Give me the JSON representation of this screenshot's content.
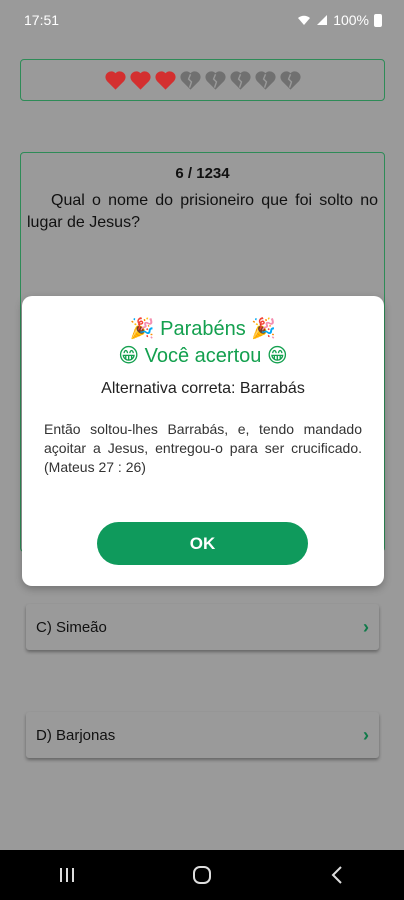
{
  "status_bar": {
    "time": "17:51",
    "battery": "100%"
  },
  "lives": {
    "total": 8,
    "remaining": 3,
    "full_color": "#d32f2f",
    "empty_color": "#707070"
  },
  "question": {
    "counter": "6 / 1234",
    "text": "Qual o nome do prisioneiro que foi solto no lugar de Jesus?"
  },
  "answers": [
    {
      "label": "C) Simeão"
    },
    {
      "label": "D) Barjonas"
    }
  ],
  "dialog": {
    "title1": "🎉 Parabéns 🎉",
    "title2": "😁 Você acertou 😁",
    "correct_answer": "Alternativa correta: Barrabás",
    "verse": "Então soltou-lhes Barrabás, e, tendo mandado açoitar a Jesus, entregou-o para ser crucificado. (Mateus 27 : 26)",
    "ok_label": "OK"
  },
  "colors": {
    "accent": "#0f9a5c",
    "border": "#2e8b57"
  }
}
